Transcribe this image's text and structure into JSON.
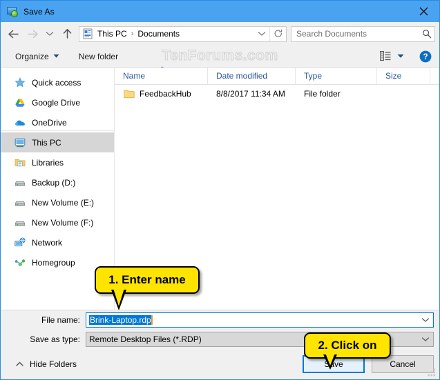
{
  "window": {
    "title": "Save As",
    "close_label": "✕"
  },
  "nav": {
    "back_icon": "back-arrow-icon",
    "forward_icon": "forward-arrow-icon",
    "recent_icon": "chevron-down-icon",
    "up_icon": "up-arrow-icon",
    "address": {
      "icon": "documents-folder-icon",
      "crumbs": [
        "This PC",
        "Documents"
      ],
      "separator": "›",
      "dropdown_icon": "chevron-down-icon",
      "refresh_icon": "refresh-icon"
    },
    "search": {
      "placeholder": "Search Documents",
      "value": "",
      "icon": "search-icon"
    }
  },
  "toolbar": {
    "organize_label": "Organize",
    "organize_caret": "▼",
    "new_folder_label": "New folder",
    "watermark": "TenForums.com",
    "view_icon": "view-layout-icon",
    "view_caret": "▼",
    "help_icon": "help-icon",
    "help_label": "?"
  },
  "sidebar": {
    "items": [
      {
        "label": "Quick access",
        "icon": "star-icon",
        "selected": false,
        "separator_above": false
      },
      {
        "label": "Google Drive",
        "icon": "google-drive-icon",
        "selected": false,
        "separator_above": false
      },
      {
        "label": "OneDrive",
        "icon": "onedrive-cloud-icon",
        "selected": false,
        "separator_above": false
      },
      {
        "label": "This PC",
        "icon": "this-pc-monitor-icon",
        "selected": true,
        "separator_above": true
      },
      {
        "label": "Libraries",
        "icon": "libraries-folder-icon",
        "selected": false,
        "separator_above": false
      },
      {
        "label": "Backup (D:)",
        "icon": "disk-drive-icon",
        "selected": false,
        "separator_above": false
      },
      {
        "label": "New Volume (E:)",
        "icon": "disk-drive-icon",
        "selected": false,
        "separator_above": false
      },
      {
        "label": "New Volume (F:)",
        "icon": "disk-drive-icon",
        "selected": false,
        "separator_above": false
      },
      {
        "label": "Network",
        "icon": "network-icon",
        "selected": false,
        "separator_above": false
      },
      {
        "label": "Homegroup",
        "icon": "homegroup-icon",
        "selected": false,
        "separator_above": false
      }
    ]
  },
  "filelist": {
    "columns": [
      "Name",
      "Date modified",
      "Type",
      "Size"
    ],
    "sort_caret": "⌃",
    "rows": [
      {
        "name": "FeedbackHub",
        "date_modified": "8/8/2017 11:34 AM",
        "type": "File folder",
        "size": ""
      }
    ]
  },
  "bottom": {
    "file_name_label": "File name:",
    "file_name_value": "Brink-Laptop.rdp",
    "save_as_type_label": "Save as type:",
    "save_as_type_value": "Remote Desktop Files (*.RDP)",
    "dropdown_icon": "chevron-down-icon",
    "hide_folders_label": "Hide Folders",
    "hide_folders_icon": "chevron-up-icon",
    "save_label": "Save",
    "cancel_label": "Cancel",
    "resize_grip_icon": "resize-grip-icon"
  },
  "callouts": [
    {
      "id": "callout1",
      "text": "1. Enter name"
    },
    {
      "id": "callout2",
      "text": "2. Click on"
    }
  ],
  "colors": {
    "accent": "#0078d7",
    "titlebar": "#4aa3f0",
    "callout": "#ffe400",
    "selection": "#0078d7"
  }
}
